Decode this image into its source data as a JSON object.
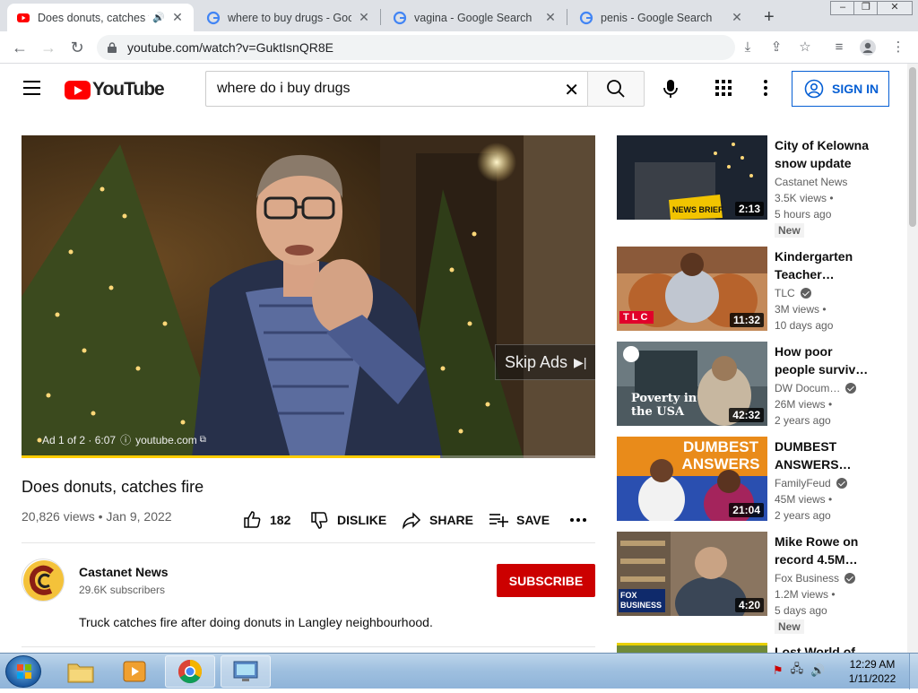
{
  "browser": {
    "tabs": [
      {
        "title": "Does donuts, catches fire",
        "active": true,
        "favicon": "youtube-icon",
        "audio": true
      },
      {
        "title": "where to buy drugs - Google Search",
        "active": false,
        "favicon": "google-icon"
      },
      {
        "title": "vagina - Google Search",
        "active": false,
        "favicon": "google-icon"
      },
      {
        "title": "penis - Google Search",
        "active": false,
        "favicon": "google-icon"
      }
    ],
    "url": "youtube.com/watch?v=GuktIsnQR8E"
  },
  "header": {
    "logo_text": "YouTube",
    "search_value": "where do i buy drugs",
    "signin_label": "SIGN IN"
  },
  "player": {
    "skip_label": "Skip Ads",
    "ad_counter": "Ad 1 of 2 · 6:07",
    "ad_domain": "youtube.com",
    "progress": 0.73
  },
  "video": {
    "title": "Does donuts, catches fire",
    "meta": "20,826 views • Jan 9, 2022",
    "likes": "182",
    "dislike_label": "DISLIKE",
    "share_label": "SHARE",
    "save_label": "SAVE",
    "channel": "Castanet News",
    "subscribers": "29.6K subscribers",
    "subscribe_label": "SUBSCRIBE",
    "description": "Truck catches fire after doing donuts in Langley neighbourhood."
  },
  "recommendations": [
    {
      "title": "City of Kelowna snow update",
      "channel": "Castanet News",
      "verified": false,
      "views": "3.5K views •",
      "age": "5 hours ago",
      "badge": "New",
      "duration": "2:13",
      "thumb_text": "NEWS BRIEF"
    },
    {
      "title": "Kindergarten Teacher…",
      "channel": "TLC",
      "verified": true,
      "views": "3M views •",
      "age": "10 days ago",
      "badge": "",
      "duration": "11:32",
      "thumb_text": "TLC"
    },
    {
      "title": "How poor people surviv…",
      "channel": "DW Docum…",
      "verified": true,
      "views": "26M views •",
      "age": "2 years ago",
      "badge": "",
      "duration": "42:32",
      "thumb_text": "Poverty in the USA"
    },
    {
      "title": "DUMBEST ANSWERS…",
      "channel": "FamilyFeud",
      "verified": true,
      "views": "45M views •",
      "age": "2 years ago",
      "badge": "",
      "duration": "21:04",
      "thumb_text": "DUMBEST ANSWERS"
    },
    {
      "title": "Mike Rowe on record 4.5M…",
      "channel": "Fox Business",
      "verified": true,
      "views": "1.2M views •",
      "age": "5 days ago",
      "badge": "New",
      "duration": "4:20",
      "thumb_text": "FOX BUSINESS"
    },
    {
      "title": "Lost World of…",
      "channel": "",
      "verified": false,
      "views": "",
      "age": "",
      "badge": "",
      "duration": "",
      "thumb_text": ""
    }
  ],
  "taskbar": {
    "time": "12:29 AM",
    "date": "1/11/2022"
  },
  "colors": {
    "youtube_red": "#ff0000",
    "subscribe_red": "#cc0000",
    "link_blue": "#065fd4",
    "progress_yellow": "#ffcc00"
  }
}
